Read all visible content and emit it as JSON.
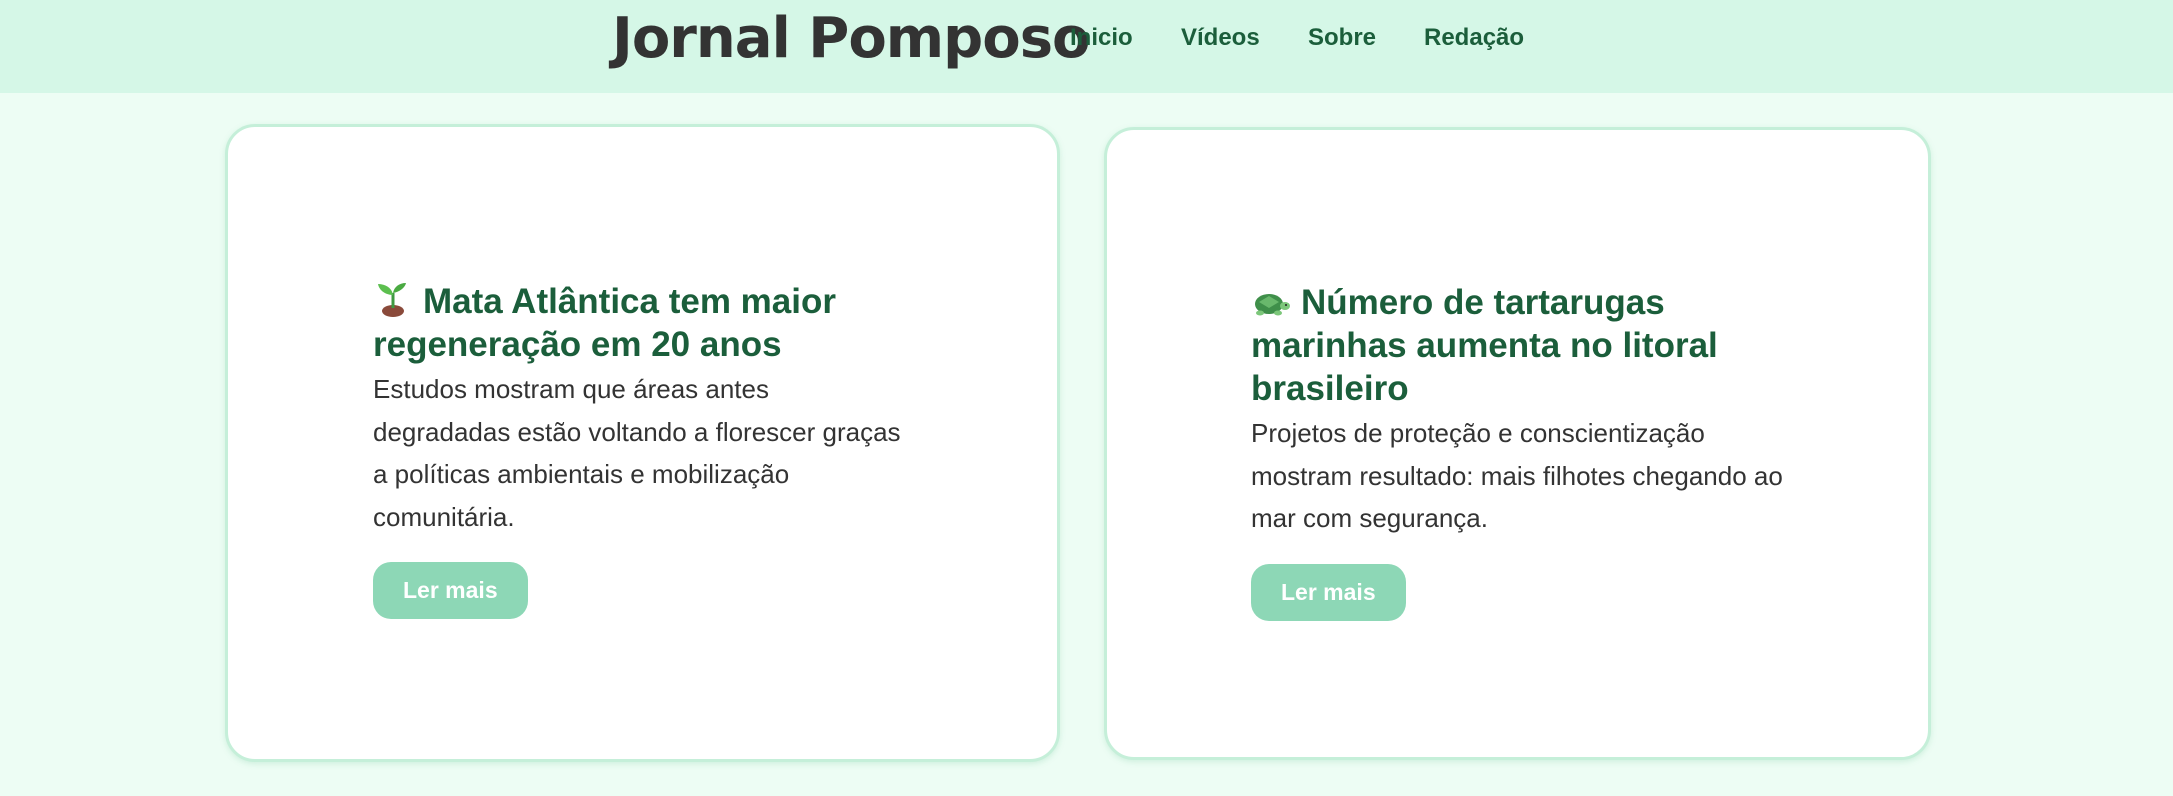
{
  "header": {
    "brand": "Jornal Pomposo",
    "nav": [
      "Inicio",
      "Vídeos",
      "Sobre",
      "Redação"
    ]
  },
  "articles": [
    {
      "icon": "seedling-icon",
      "title": "Mata Atlântica tem maior regeneração em 20 anos",
      "text": "Estudos mostram que áreas antes degradadas estão voltando a florescer graças a políticas ambientais e mobilização comunitária.",
      "button": "Ler mais"
    },
    {
      "icon": "turtle-icon",
      "title": "Número de tartarugas marinhas aumenta no litoral brasileiro",
      "text": "Projetos de proteção e conscientização mostram resultado: mais filhotes chegando ao mar com segurança.",
      "button": "Ler mais"
    }
  ],
  "colors": {
    "page_background": "#edfdf4",
    "header_background": "#d5f7e7",
    "accent_text": "#1b5e3b",
    "button": "#8dd7b6",
    "card_border": "#c5efd9"
  }
}
